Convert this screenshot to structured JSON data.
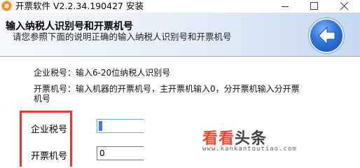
{
  "window": {
    "title": "开票软件 V2.2.34.190427 安装"
  },
  "header": {
    "title": "输入纳税人识别号和开票机号",
    "subtitle": "请您参照下面的说明正确的输入纳税人识别号和开票机号"
  },
  "instructions": {
    "tax_id": "企业税号：输入6-20位纳税人识别号",
    "invoice_machine_line1": "开票机号：输入机器的开票机号，主开票机输入0，分开票机输入分开票",
    "invoice_machine_line2": "机号"
  },
  "form": {
    "tax_id_label": "企业税号",
    "tax_id_value": "",
    "invoice_machine_label": "开票机号",
    "invoice_machine_value": "0"
  },
  "watermark": {
    "logo_part1": "看看",
    "logo_part2": "头条",
    "url": "www.kankantoutiao.com"
  },
  "colors": {
    "highlight_border": "#e53a33",
    "back_button": "#2f74d8",
    "header_gradient_end": "#c5d8ef"
  },
  "icons": {
    "app": "app-logo-icon",
    "back": "back-arrow-icon"
  }
}
